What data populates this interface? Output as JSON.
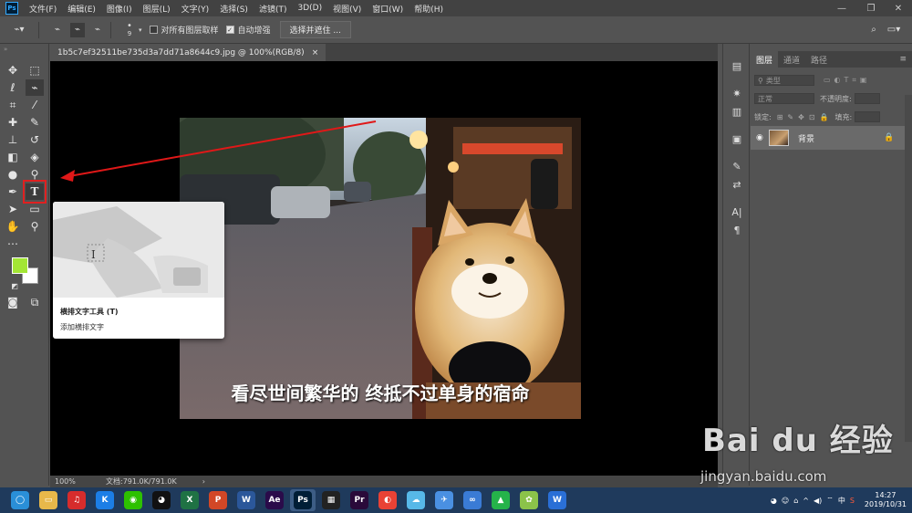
{
  "menubar": {
    "logo": "Ps",
    "items": [
      "文件(F)",
      "编辑(E)",
      "图像(I)",
      "图层(L)",
      "文字(Y)",
      "选择(S)",
      "滤镜(T)",
      "3D(D)",
      "视图(V)",
      "窗口(W)",
      "帮助(H)"
    ],
    "minimize": "—",
    "maximize": "❐",
    "close": "✕"
  },
  "options": {
    "brush_size": "9",
    "sample_all_label": "对所有图层取样",
    "auto_enhance_label": "自动增强",
    "select_mask_label": "选择并遮住 ..."
  },
  "document": {
    "tab_title": "1b5c7ef32511be735d3a7dd71a8644c9.jpg @ 100%(RGB/8)",
    "tab_close": "×",
    "caption": "看尽世间繁华的 终抵不过单身的宿命"
  },
  "status": {
    "zoom": "100%",
    "doc_info": "文档:791.0K/791.0K",
    "arrow": "›"
  },
  "tooltip": {
    "title": "横排文字工具 (T)",
    "description": "添加横排文字"
  },
  "layers_panel": {
    "tabs": [
      "图层",
      "通道",
      "路径"
    ],
    "filter_label": "类型",
    "blend_mode": "正常",
    "opacity_label": "不透明度:",
    "lock_label": "锁定:",
    "fill_label": "填充:",
    "layer_name": "背景"
  },
  "taskbar": {
    "apps": [
      {
        "name": "cortana",
        "glyph": "◯",
        "color": "#2a8fd8"
      },
      {
        "name": "file-explorer",
        "glyph": "▭",
        "color": "#e8b84a"
      },
      {
        "name": "netease-music",
        "glyph": "♫",
        "color": "#d62c2c"
      },
      {
        "name": "kugou",
        "glyph": "K",
        "color": "#1c7ee6"
      },
      {
        "name": "wechat",
        "glyph": "◉",
        "color": "#2dc100"
      },
      {
        "name": "qq",
        "glyph": "◕",
        "color": "#111111"
      },
      {
        "name": "excel",
        "glyph": "X",
        "color": "#1f7244"
      },
      {
        "name": "powerpoint",
        "glyph": "P",
        "color": "#d24726"
      },
      {
        "name": "word",
        "glyph": "W",
        "color": "#2b579a"
      },
      {
        "name": "after-effects",
        "glyph": "Ae",
        "color": "#2a0b4a"
      },
      {
        "name": "photoshop",
        "glyph": "Ps",
        "color": "#001e36"
      },
      {
        "name": "video-editor",
        "glyph": "▦",
        "color": "#222222"
      },
      {
        "name": "premiere",
        "glyph": "Pr",
        "color": "#2a0a3a"
      },
      {
        "name": "chrome-like",
        "glyph": "◐",
        "color": "#e94235"
      },
      {
        "name": "app-cat",
        "glyph": "☁",
        "color": "#57b8e8"
      },
      {
        "name": "app-bird",
        "glyph": "✈",
        "color": "#4a90e2"
      },
      {
        "name": "app-link",
        "glyph": "∞",
        "color": "#3a7bd5"
      },
      {
        "name": "app-green",
        "glyph": "▲",
        "color": "#25b34a"
      },
      {
        "name": "app-colorful",
        "glyph": "✿",
        "color": "#8bc34a"
      },
      {
        "name": "wps",
        "glyph": "W",
        "color": "#2a6fd6"
      }
    ],
    "tray_lang": "中",
    "time": "14:27",
    "date": "2019/10/31"
  },
  "watermark": {
    "logo": "Bai du 经验",
    "url": "jingyan.baidu.com"
  },
  "colors": {
    "foreground": "#a3e635",
    "background": "#ffffff",
    "highlight": "#e02020"
  }
}
